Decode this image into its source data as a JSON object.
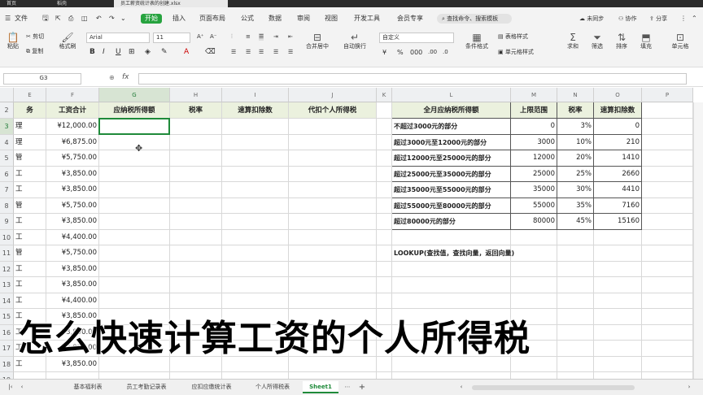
{
  "window": {
    "tabs": [
      {
        "label": "首页"
      },
      {
        "label": "稻壳"
      },
      {
        "label": "员工薪资统计表的创建.xlsx"
      }
    ]
  },
  "menu": {
    "file": "文件",
    "items": [
      "开始",
      "插入",
      "页面布局",
      "公式",
      "数据",
      "审阅",
      "视图",
      "开发工具",
      "会员专享"
    ],
    "search_placeholder": "查找命令、搜索模板",
    "sync": "未同步",
    "collab": "协作",
    "share": "分享"
  },
  "toolbar": {
    "paste": "粘贴",
    "cut": "剪切",
    "copy": "复制",
    "format_painter": "格式刷",
    "font_name": "Arial",
    "font_size": "11",
    "merge_center": "合并居中",
    "auto_wrap": "自动换行",
    "number_format": "自定义",
    "cond_format": "条件格式",
    "table_style": "表格样式",
    "cell_style": "单元格样式",
    "sum": "求和",
    "filter": "筛选",
    "sort": "排序",
    "fill": "填充",
    "cell": "单元格"
  },
  "formula_bar": {
    "name_box": "G3",
    "fx": "fx",
    "content": ""
  },
  "columns": [
    "E",
    "F",
    "G",
    "H",
    "I",
    "J",
    "K",
    "L",
    "M",
    "N",
    "O",
    "P"
  ],
  "rows": [
    "2",
    "3",
    "4",
    "5",
    "6",
    "7",
    "8",
    "9",
    "10",
    "11",
    "12",
    "13",
    "14",
    "15",
    "16",
    "17",
    "18",
    "19"
  ],
  "main_table": {
    "headers": [
      "务",
      "工资合计",
      "应纳税所得额",
      "税率",
      "速算扣除数",
      "代扣个人所得税"
    ],
    "rows": [
      [
        "理",
        "¥12,000.00"
      ],
      [
        "理",
        "¥6,875.00"
      ],
      [
        "管",
        "¥5,750.00"
      ],
      [
        "工",
        "¥3,850.00"
      ],
      [
        "工",
        "¥3,850.00"
      ],
      [
        "管",
        "¥5,750.00"
      ],
      [
        "工",
        "¥3,850.00"
      ],
      [
        "工",
        "¥4,400.00"
      ],
      [
        "管",
        "¥5,750.00"
      ],
      [
        "工",
        "¥3,850.00"
      ],
      [
        "工",
        "¥3,850.00"
      ],
      [
        "工",
        "¥4,400.00"
      ],
      [
        "工",
        "¥3,850.00"
      ],
      [
        "工",
        "¥3,850.00"
      ],
      [
        "工",
        "¥3,850.00"
      ],
      [
        "工",
        "¥3,850.00"
      ]
    ]
  },
  "tax_table": {
    "headers": [
      "全月应纳税所得额",
      "上限范围",
      "税率",
      "速算扣除数"
    ],
    "rows": [
      [
        "不超过3000元的部分",
        "0",
        "3%",
        "0"
      ],
      [
        "超过3000元至12000元的部分",
        "3000",
        "10%",
        "210"
      ],
      [
        "超过12000元至25000元的部分",
        "12000",
        "20%",
        "1410"
      ],
      [
        "超过25000元至35000元的部分",
        "25000",
        "25%",
        "2660"
      ],
      [
        "超过35000元至55000元的部分",
        "35000",
        "30%",
        "4410"
      ],
      [
        "超过55000元至80000元的部分",
        "55000",
        "35%",
        "7160"
      ],
      [
        "超过80000元的部分",
        "80000",
        "45%",
        "15160"
      ]
    ]
  },
  "note": "LOOKUP(查找值，查找向量，返回向量)",
  "sheet_tabs": [
    "基本福利表",
    "员工考勤记录表",
    "应扣应缴统计表",
    "个人所得税表",
    "Sheet1"
  ],
  "caption": "怎么快速计算工资的个人所得税"
}
